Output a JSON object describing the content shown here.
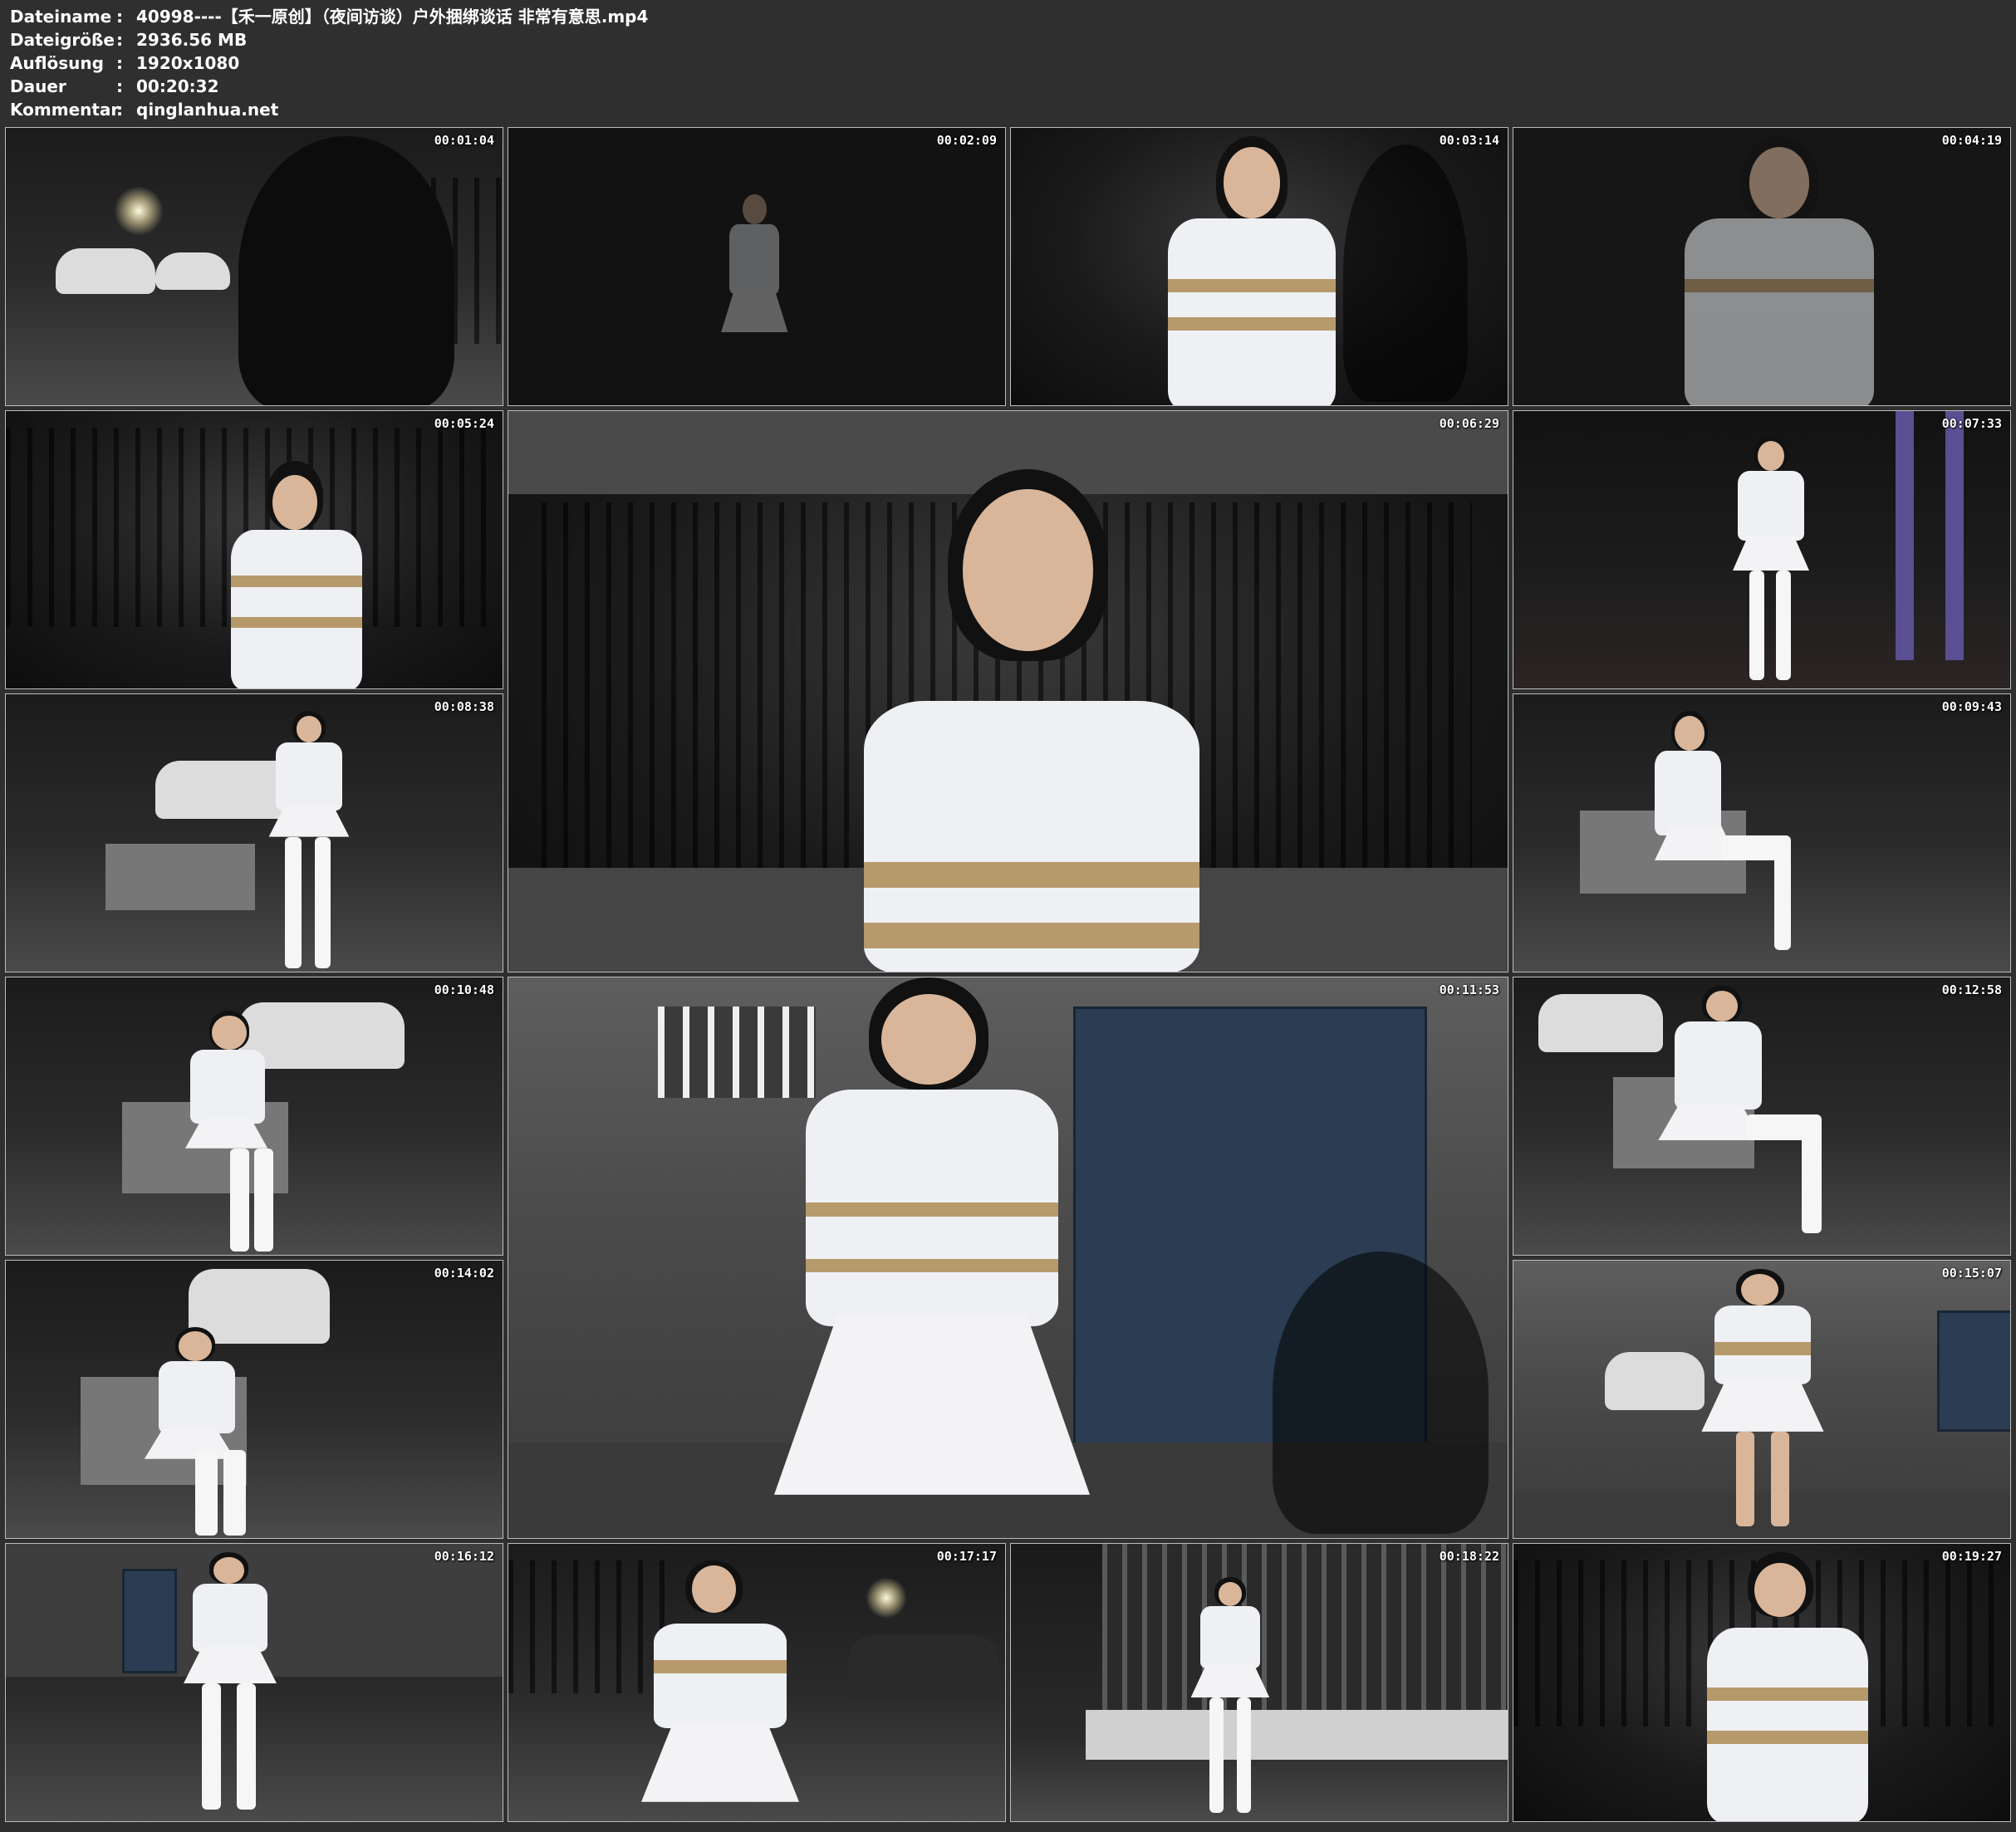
{
  "meta": {
    "rows": [
      {
        "key": "Dateiname",
        "sep": ":",
        "value": "40998----【禾一原创】（夜间访谈）户外捆绑谈话 非常有意思.mp4"
      },
      {
        "key": "Dateigröße",
        "sep": ":",
        "value": "2936.56 MB"
      },
      {
        "key": "Auflösung",
        "sep": ":",
        "value": "1920x1080"
      },
      {
        "key": "Dauer",
        "sep": ":",
        "value": "00:20:32"
      },
      {
        "key": "Kommentar",
        "sep": ":",
        "value": "qinglanhua.net"
      }
    ]
  },
  "thumbnails": [
    {
      "time": "00:01:04"
    },
    {
      "time": "00:02:09"
    },
    {
      "time": "00:03:14"
    },
    {
      "time": "00:04:19"
    },
    {
      "time": "00:05:24"
    },
    {
      "time": "00:06:29"
    },
    {
      "time": "00:07:33"
    },
    {
      "time": "00:08:38"
    },
    {
      "time": "00:09:43"
    },
    {
      "time": "00:10:48"
    },
    {
      "time": "00:11:53"
    },
    {
      "time": "00:12:58"
    },
    {
      "time": "00:14:02"
    },
    {
      "time": "00:15:07"
    },
    {
      "time": "00:16:12"
    },
    {
      "time": "00:17:17"
    },
    {
      "time": "00:18:22"
    },
    {
      "time": "00:19:27"
    }
  ]
}
